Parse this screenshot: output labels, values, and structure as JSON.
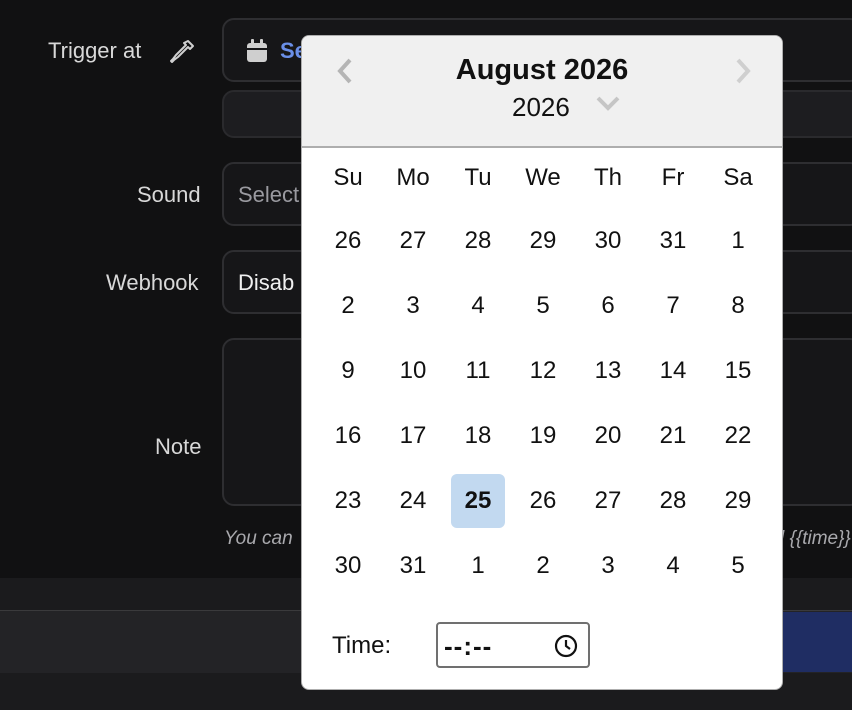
{
  "form": {
    "trigger_label": "Trigger at",
    "trigger_value_partial": "Se",
    "sound_label": "Sound",
    "sound_value_partial": "Select",
    "webhook_label": "Webhook",
    "webhook_value_partial": "Disab",
    "note_label": "Note",
    "hint_left": "You can",
    "hint_right": "l {{time}}"
  },
  "calendar": {
    "month_title": "August 2026",
    "year": "2026",
    "weekdays": [
      "Su",
      "Mo",
      "Tu",
      "We",
      "Th",
      "Fr",
      "Sa"
    ],
    "weeks": [
      [
        "26",
        "27",
        "28",
        "29",
        "30",
        "31",
        "1"
      ],
      [
        "2",
        "3",
        "4",
        "5",
        "6",
        "7",
        "8"
      ],
      [
        "9",
        "10",
        "11",
        "12",
        "13",
        "14",
        "15"
      ],
      [
        "16",
        "17",
        "18",
        "19",
        "20",
        "21",
        "22"
      ],
      [
        "23",
        "24",
        "25",
        "26",
        "27",
        "28",
        "29"
      ],
      [
        "30",
        "31",
        "1",
        "2",
        "3",
        "4",
        "5"
      ]
    ],
    "selected_day": "25",
    "time_label": "Time:",
    "time_value": "--:--"
  },
  "colors": {
    "accent": "#6a8fe8",
    "selected": "#c2d9f0",
    "bottom_button": "#1f2d63"
  }
}
